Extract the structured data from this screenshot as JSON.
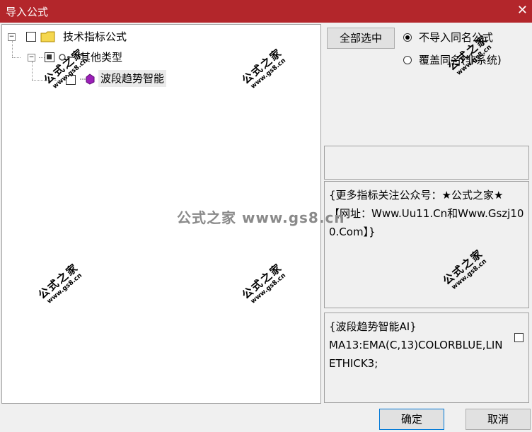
{
  "window": {
    "title": "导入公式",
    "close_glyph": "✕"
  },
  "tree": {
    "root": {
      "label": "技术指标公式",
      "expander": "−"
    },
    "group": {
      "label": "其他类型",
      "expander": "−"
    },
    "item": {
      "label": "波段趋势智能"
    }
  },
  "actions": {
    "select_all_label": "全部选中",
    "radio_skip_label": "不导入同名公式",
    "radio_overwrite_label": "覆盖同名(非系统)",
    "radio_selected": "skip"
  },
  "info_text": "{更多指标关注公众号：★公式之家★ 【网址：Www.Uu11.Cn和Www.Gszj100.Com】}",
  "code_text": "{波段趋势智能AI}\nMA13:EMA(C,13)COLORBLUE,LINETHICK3;",
  "footer": {
    "ok_label": "确定",
    "cancel_label": "取消"
  },
  "watermark": {
    "big": "公式之家",
    "small": "www.gs8.cn",
    "center": "公式之家 www.gs8.cn"
  },
  "colors": {
    "titlebar": "#b3262b",
    "folder": "#f5d74e",
    "formula_icon": "#9b1fb8"
  }
}
